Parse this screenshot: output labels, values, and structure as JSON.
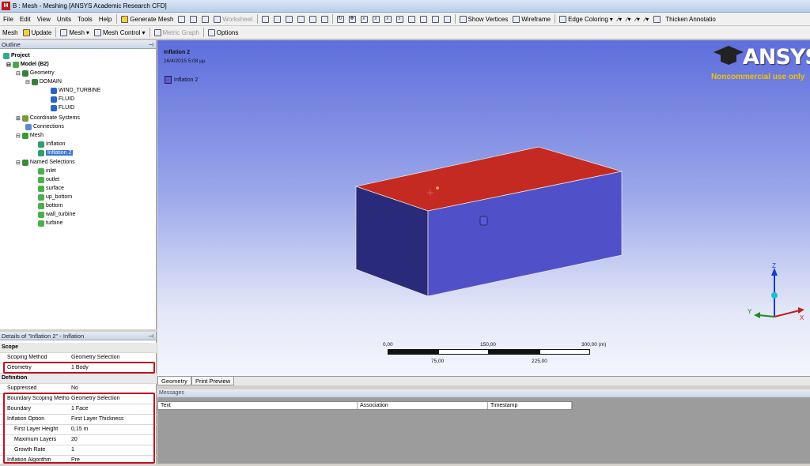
{
  "window": {
    "title": "B : Mesh - Meshing [ANSYS Academic Research CFD]",
    "icon_label": "M"
  },
  "menu": [
    "File",
    "Edit",
    "View",
    "Units",
    "Tools",
    "Help"
  ],
  "toolbar1": {
    "generate_mesh": "Generate Mesh",
    "worksheet": "Worksheet",
    "show_vertices": "Show Vertices",
    "wireframe": "Wireframe",
    "edge_coloring": "Edge Coloring",
    "thicken": "Thicken Annotatio"
  },
  "toolbar2": {
    "mesh": "Mesh",
    "update": "Update",
    "mesh_menu": "Mesh",
    "mesh_control": "Mesh Control",
    "metric_graph": "Metric Graph",
    "options": "Options"
  },
  "outline": {
    "title": "Outline",
    "items": [
      {
        "label": "Project"
      },
      {
        "label": "Model (B2)"
      },
      {
        "label": "Geometry"
      },
      {
        "label": "DOMAIN"
      },
      {
        "label": "WIND_TURBINE"
      },
      {
        "label": "FLUID"
      },
      {
        "label": "FLUID"
      },
      {
        "label": "Coordinate Systems"
      },
      {
        "label": "Connections"
      },
      {
        "label": "Mesh"
      },
      {
        "label": "Inflation"
      },
      {
        "label": "Inflation 2"
      },
      {
        "label": "Named Selections"
      },
      {
        "label": "inlet"
      },
      {
        "label": "outlet"
      },
      {
        "label": "surface"
      },
      {
        "label": "up_bottom"
      },
      {
        "label": "bottom"
      },
      {
        "label": "wall_turbine"
      },
      {
        "label": "turbine"
      }
    ]
  },
  "viewport": {
    "title": "Inflation 2",
    "date": "16/4/2015 5:08 μμ",
    "legend_label": "Inflation 2",
    "logo_word": "ANSYS",
    "logo_sub": "Noncommercial use only",
    "scale_top": [
      "0,00",
      "150,00",
      "300,00 (m)"
    ],
    "scale_bottom": [
      "75,00",
      "225,00"
    ],
    "axis_z": "Z",
    "axis_y": "Y",
    "axis_x": "X",
    "colors": {
      "top_face": "#c42a22",
      "side_face": "#5050c8",
      "accent": "#3875d7"
    }
  },
  "tabs": [
    "Geometry",
    "Print Preview"
  ],
  "details": {
    "title": "Details of \"Inflation 2\" - Inflation",
    "rows": [
      {
        "key": "Scope",
        "value": ""
      },
      {
        "key": "Scoping Method",
        "value": "Geometry Selection"
      },
      {
        "key": "Geometry",
        "value": "1 Body"
      },
      {
        "key": "Definition",
        "value": ""
      },
      {
        "key": "Suppressed",
        "value": "No"
      },
      {
        "key": "Boundary Scoping Method",
        "value": "Geometry Selection"
      },
      {
        "key": "Boundary",
        "value": "1 Face"
      },
      {
        "key": "Inflation Option",
        "value": "First Layer Thickness"
      },
      {
        "key": "First Layer Height",
        "value": "0,15 m"
      },
      {
        "key": "Maximum Layers",
        "value": "20"
      },
      {
        "key": "Growth Rate",
        "value": "1"
      },
      {
        "key": "Inflation Algorithm",
        "value": "Pre"
      }
    ]
  },
  "messages": {
    "title": "Messages",
    "columns": [
      "Text",
      "Association",
      "Timestamp"
    ]
  }
}
